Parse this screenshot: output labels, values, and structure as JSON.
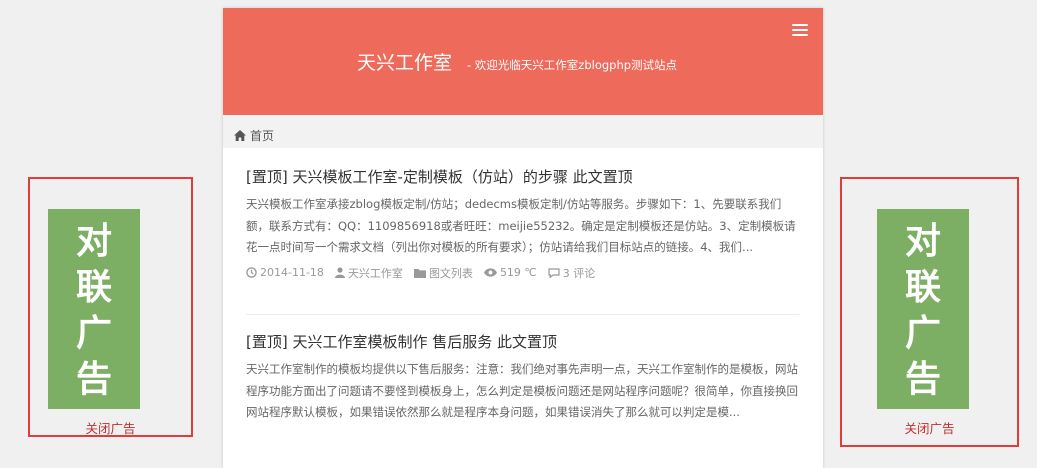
{
  "header": {
    "site_title": "天兴工作室",
    "site_desc": "- 欢迎光临天兴工作室zblogphp测试站点",
    "menu_icon": "bars-icon",
    "bg_color": "#ee6a5b"
  },
  "breadcrumb": {
    "home_icon": "home-icon",
    "home_label": "首页"
  },
  "posts": [
    {
      "title": "[置顶] 天兴模板工作室-定制模板（仿站）的步骤 此文置顶",
      "excerpt": "天兴模板工作室承接zblog模板定制/仿站；dedecms模板定制/仿站等服务。步骤如下：1、先要联系我们额，联系方式有：QQ：1109856918或者旺旺：meijie55232。确定是定制模板还是仿站。3、定制模板请花一点时间写一个需求文档（列出你对模板的所有要求）；仿站请给我们目标站点的链接。4、我们...",
      "date": "2014-11-18",
      "author": "天兴工作室",
      "category": "图文列表",
      "views": "519 ℃",
      "comments": "3 评论"
    },
    {
      "title": "[置顶] 天兴工作室模板制作 售后服务 此文置顶",
      "excerpt": "天兴工作室制作的模板均提供以下售后服务：注意：我们绝对事先声明一点，天兴工作室制作的是模板，网站程序功能方面出了问题请不要怪到模板身上，怎么判定是模板问题还是网站程序问题呢？很简单，你直接换回网站程序默认模板，如果错误依然那么就是程序本身问题，如果错误消失了那么就可以判定是模..."
    }
  ],
  "ads": {
    "left": {
      "chars": [
        "对",
        "联",
        "广",
        "告"
      ],
      "close_label": "关闭广告"
    },
    "right": {
      "chars": [
        "对",
        "联",
        "广",
        "告"
      ],
      "close_label": "关闭广告"
    },
    "green": "#7cae63",
    "border": "#e03c3c"
  }
}
